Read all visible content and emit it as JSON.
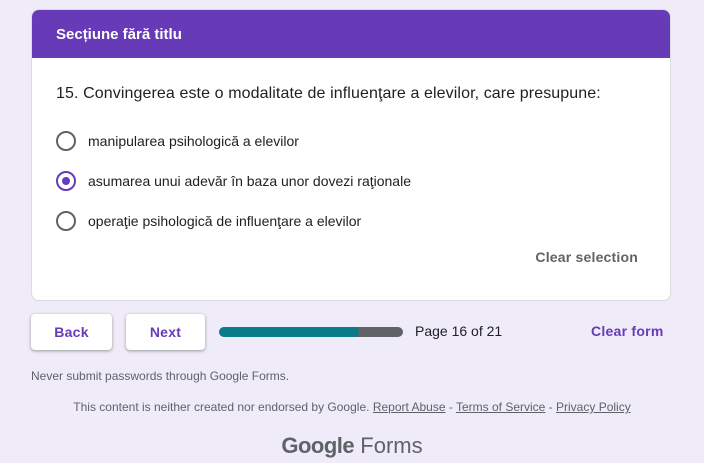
{
  "section": {
    "title": "Secțiune fără titlu"
  },
  "question": {
    "text": "15. Convingerea este o modalitate de influenţare a elevilor, care presupune:",
    "options": [
      {
        "label": "manipularea psihologică a elevilor",
        "selected": false
      },
      {
        "label": "asumarea unui adevăr în baza unor dovezi raţionale",
        "selected": true
      },
      {
        "label": "operaţie psihologică de influenţare a elevilor",
        "selected": false
      }
    ],
    "clear_selection_label": "Clear selection"
  },
  "navigation": {
    "back_label": "Back",
    "next_label": "Next",
    "page_text": "Page 16 of 21",
    "progress_fraction": 0.76,
    "clear_form_label": "Clear form"
  },
  "footer": {
    "never_submit": "Never submit passwords through Google Forms.",
    "disclaimer": "This content is neither created nor endorsed by Google.",
    "report_abuse": "Report Abuse",
    "terms": "Terms of Service",
    "privacy": "Privacy Policy",
    "separator": " - ",
    "logo_google": "Google",
    "logo_forms": "Forms"
  },
  "colors": {
    "accent": "#673ab7",
    "background": "#efebf8",
    "progress_fill": "#0b7b8b",
    "progress_track": "#5f6368"
  }
}
